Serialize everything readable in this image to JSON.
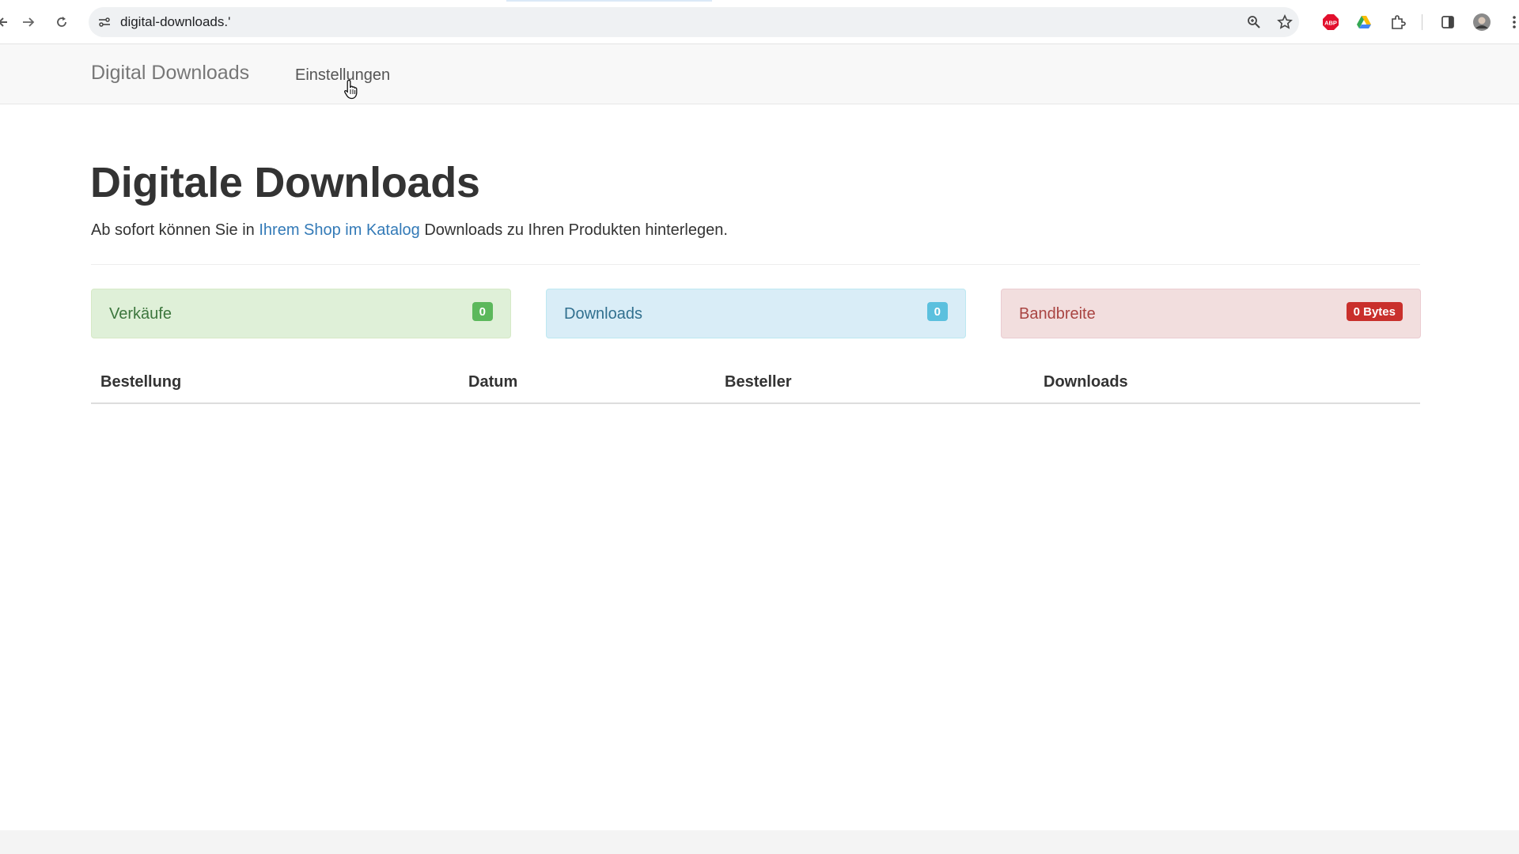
{
  "browser": {
    "url": "digital-downloads.'",
    "icons": [
      "back-icon",
      "forward-icon",
      "reload-icon",
      "site-info-icon",
      "zoom-icon",
      "bookmark-star-icon",
      "adblock-plus-icon",
      "google-drive-icon",
      "extensions-puzzle-icon",
      "side-panel-icon",
      "profile-avatar-icon",
      "more-menu-icon"
    ],
    "adblock_label": "ABP"
  },
  "navbar": {
    "brand": "Digital Downloads",
    "links": [
      "Einstellungen"
    ]
  },
  "main": {
    "title": "Digitale Downloads",
    "lead_prefix": "Ab sofort können Sie in ",
    "lead_link": "Ihrem Shop im Katalog",
    "lead_suffix": " Downloads zu Ihren Produkten hinterlegen."
  },
  "stats": [
    {
      "label": "Verkäufe",
      "value": "0",
      "style": "success"
    },
    {
      "label": "Downloads",
      "value": "0",
      "style": "info"
    },
    {
      "label": "Bandbreite",
      "value": "0 Bytes",
      "style": "danger"
    }
  ],
  "table": {
    "columns": [
      "Bestellung",
      "Datum",
      "Besteller",
      "Downloads"
    ],
    "rows": []
  },
  "colors": {
    "link": "#337ab7",
    "success_bg": "#dff0d8",
    "info_bg": "#d9edf7",
    "danger_bg": "#f2dede"
  }
}
